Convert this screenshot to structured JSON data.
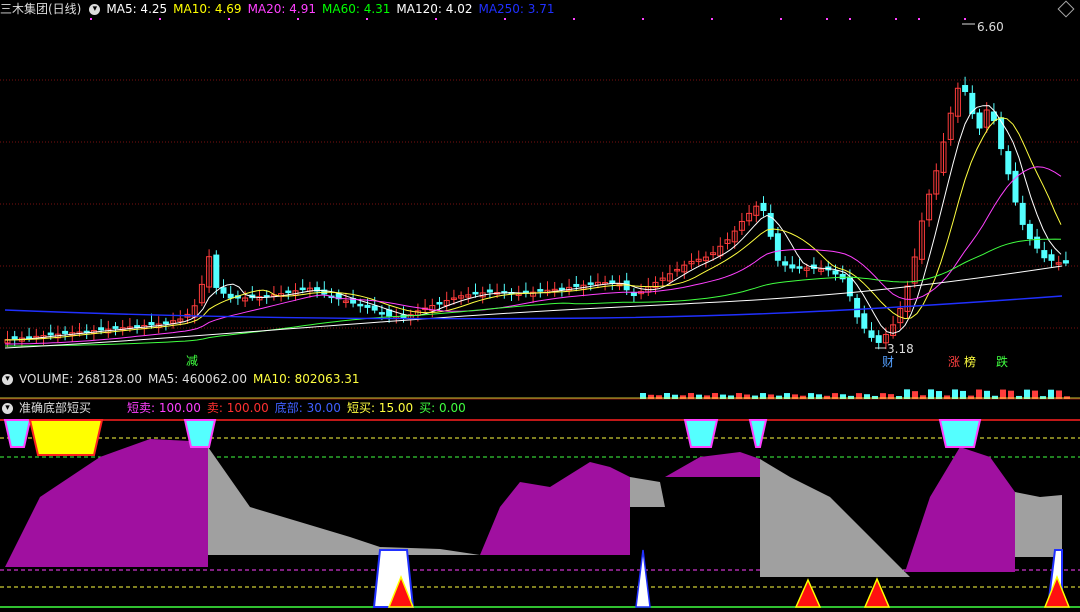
{
  "main_header": {
    "stock_title": "三木集团(日线)",
    "indicators": [
      {
        "label": "MA5: 4.25",
        "color": "#ffffff"
      },
      {
        "label": "MA10: 4.69",
        "color": "#ffff00"
      },
      {
        "label": "MA20: 4.91",
        "color": "#ff40ff"
      },
      {
        "label": "MA60: 4.31",
        "color": "#00ff00"
      },
      {
        "label": "MA120: 4.02",
        "color": "#ffffff"
      },
      {
        "label": "MA250: 3.71",
        "color": "#2030ff"
      }
    ]
  },
  "price_labels": {
    "high": "6.60",
    "low": "3.18"
  },
  "signal_tags": {
    "jian": "减",
    "cai": "财",
    "zhang": "涨",
    "bang": "榜",
    "die": "跌"
  },
  "volume_header": {
    "label": "VOLUME: 268128.00",
    "ma5": "MA5: 460062.00",
    "ma10": "MA10: 802063.31"
  },
  "indicator_header": {
    "name": "准确底部短买",
    "items": [
      {
        "label": "短卖: 100.00",
        "color": "#ff40ff"
      },
      {
        "label": "卖: 100.00",
        "color": "#ff3030"
      },
      {
        "label": "底部: 30.00",
        "color": "#4060ff"
      },
      {
        "label": "短买: 15.00",
        "color": "#ffff40"
      },
      {
        "label": "买: 0.00",
        "color": "#40ff40"
      }
    ]
  },
  "colors": {
    "up": "#ff3c3c",
    "down": "#54ffff",
    "background": "#000000"
  }
}
